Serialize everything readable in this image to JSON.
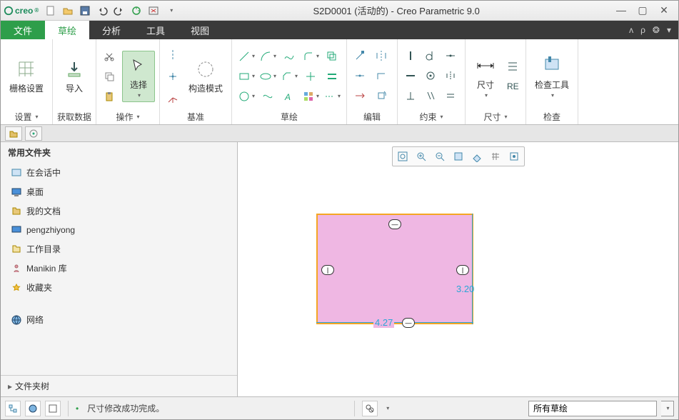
{
  "app": {
    "brand": "creo",
    "title": "S2D0001 (活动的) - Creo Parametric 9.0"
  },
  "tabs": {
    "file": "文件",
    "sketch": "草绘",
    "analysis": "分析",
    "tools": "工具",
    "view": "视图"
  },
  "ribbon": {
    "setup": {
      "grid": "栅格设置",
      "label": "设置",
      "dd": "▾"
    },
    "getdata": {
      "import": "导入",
      "label": "获取数据"
    },
    "operate": {
      "select": "选择",
      "label": "操作",
      "dd": "▾"
    },
    "datum": {
      "construct": "构造模式",
      "label": "基准"
    },
    "sketch": {
      "label": "草绘"
    },
    "edit": {
      "label": "编辑"
    },
    "constrain": {
      "label": "约束",
      "dd": "▾"
    },
    "dimension": {
      "big": "尺寸",
      "label": "尺寸",
      "dd": "▾"
    },
    "inspect": {
      "big": "检查工具",
      "label": "检查",
      "dd": "▾"
    }
  },
  "sidebar": {
    "header": "常用文件夹",
    "items": [
      {
        "icon": "session",
        "label": "在会话中"
      },
      {
        "icon": "desktop",
        "label": "桌面"
      },
      {
        "icon": "documents",
        "label": "我的文档"
      },
      {
        "icon": "computer",
        "label": "pengzhiyong"
      },
      {
        "icon": "workdir",
        "label": "工作目录"
      },
      {
        "icon": "manikin",
        "label": "Manikin 库"
      },
      {
        "icon": "favorites",
        "label": "收藏夹"
      },
      {
        "icon": "network",
        "label": "网络"
      }
    ],
    "tree": "文件夹树"
  },
  "chart_data": {
    "type": "table",
    "title": "sketch-rectangle-dimensions",
    "values": {
      "width": 4.27,
      "height": 3.2
    }
  },
  "sketch": {
    "dimx": "4.27",
    "dimy": "3.20"
  },
  "status": {
    "message": "尺寸修改成功完成。",
    "filter": "所有草绘"
  }
}
